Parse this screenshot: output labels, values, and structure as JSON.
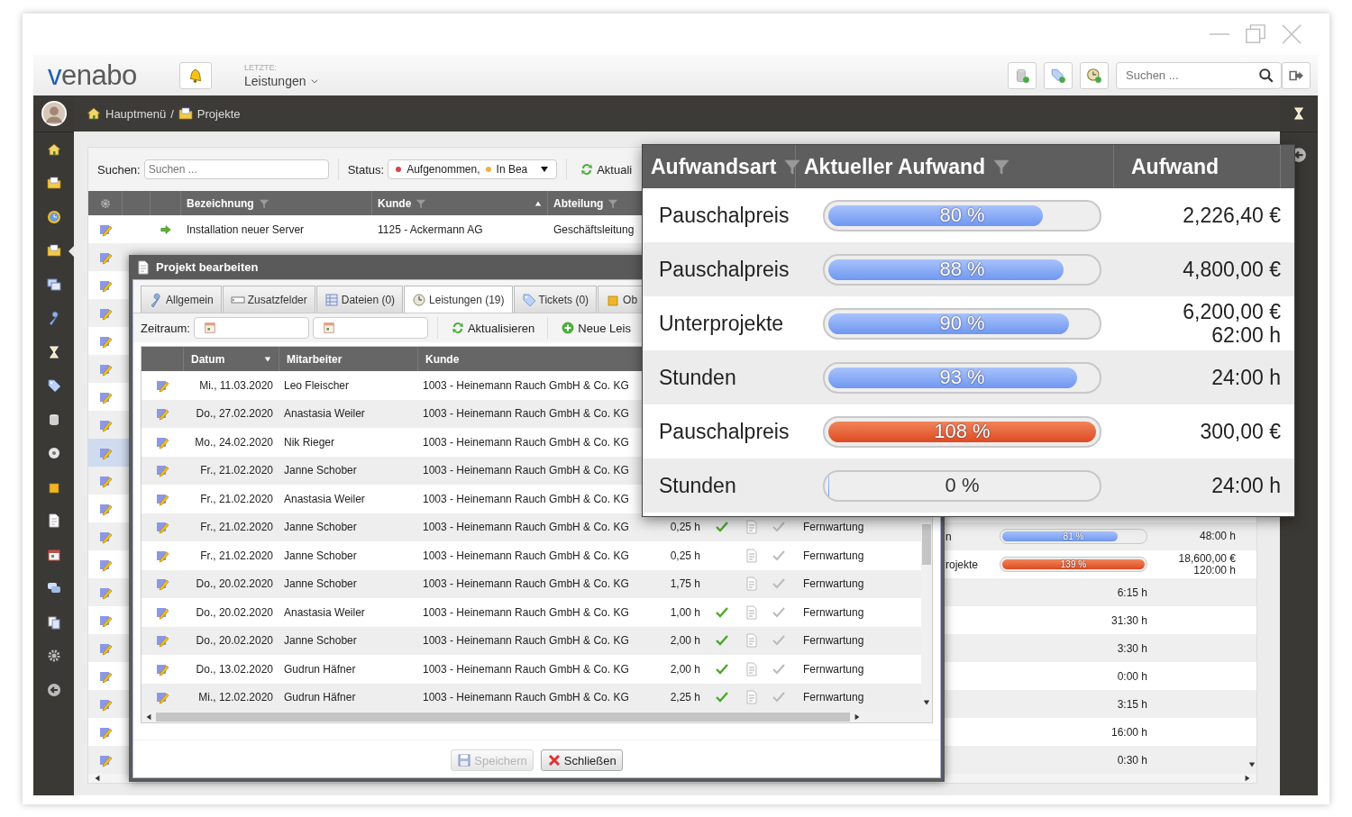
{
  "topbar": {
    "logo": "venabo",
    "recent_label": "LETZTE:",
    "recent_value": "Leistungen",
    "search_placeholder": "Suchen ..."
  },
  "breadcrumb": {
    "items": [
      "Hauptmenü",
      "Projekte"
    ],
    "separator": "/"
  },
  "sidebar": {
    "items": [
      {
        "selected": false
      },
      {
        "selected": false
      },
      {
        "selected": false
      },
      {
        "selected": true
      },
      {
        "selected": false
      },
      {
        "selected": false
      },
      {
        "selected": false
      },
      {
        "selected": false
      },
      {
        "selected": false
      },
      {
        "selected": false
      },
      {
        "selected": false
      },
      {
        "selected": false
      },
      {
        "selected": false
      },
      {
        "selected": false
      },
      {
        "selected": false
      },
      {
        "selected": false
      },
      {
        "selected": false
      }
    ]
  },
  "toolbar": {
    "search_label": "Suchen:",
    "search_placeholder": "Suchen ...",
    "status_label": "Status:",
    "status_values": [
      {
        "label": "Aufgenommen,",
        "color": "#d9434b"
      },
      {
        "label": "In Bea",
        "color": "#f0b040"
      }
    ],
    "refresh": "Aktuali"
  },
  "table": {
    "columns": [
      "Bezeichnung",
      "Kunde",
      "Abteilung"
    ],
    "rows": [
      {
        "selected": false,
        "name": "Installation neuer Server",
        "customer": "1125 - Ackermann AG",
        "department": "Geschäftsleitung"
      },
      {
        "selected": false
      },
      {
        "selected": false
      },
      {
        "selected": false
      },
      {
        "selected": false
      },
      {
        "selected": false
      },
      {
        "selected": false
      },
      {
        "selected": false
      },
      {
        "selected": true
      },
      {
        "selected": false
      },
      {
        "selected": false
      },
      {
        "selected": false,
        "type": "n",
        "level": 0.81,
        "overrun": false,
        "reading": "81 %",
        "amount": [
          "48:00 h"
        ]
      },
      {
        "selected": false,
        "type": "rojekte",
        "level": 1,
        "overrun": true,
        "reading": "139 %",
        "amount": [
          "18,600,00 €",
          "120:00 h"
        ]
      },
      {
        "selected": false,
        "current": "6:15 h"
      },
      {
        "selected": false,
        "current": "31:30 h"
      },
      {
        "selected": false,
        "current": "3:30 h"
      },
      {
        "selected": false,
        "current": "0:00 h"
      },
      {
        "selected": false,
        "current": "3:15 h"
      },
      {
        "selected": false,
        "current": "16:00 h"
      },
      {
        "selected": false,
        "current": "0:30 h"
      }
    ]
  },
  "dialog": {
    "title": "Projekt bearbeiten",
    "tabs": [
      {
        "label": "Allgemein",
        "selected": false
      },
      {
        "label": "Zusatzfelder",
        "selected": false
      },
      {
        "label": "Dateien (0)",
        "selected": false
      },
      {
        "label": "Leistungen (19)",
        "selected": true
      },
      {
        "label": "Tickets (0)",
        "selected": false
      },
      {
        "label": "Ob",
        "selected": false
      }
    ],
    "period_label": "Zeitraum:",
    "refresh": "Aktualisieren",
    "new": "Neue Leis",
    "columns": [
      "Datum",
      "Mitarbeiter",
      "Kunde"
    ],
    "rows": [
      {
        "date": "Mi., 11.03.2020",
        "employee": "Leo Fleischer",
        "customer": "1003 - Heinemann Rauch GmbH & Co. KG"
      },
      {
        "date": "Do., 27.02.2020",
        "employee": "Anastasia Weiler",
        "customer": "1003 - Heinemann Rauch GmbH & Co. KG"
      },
      {
        "date": "Mo., 24.02.2020",
        "employee": "Nik Rieger",
        "customer": "1003 - Heinemann Rauch GmbH & Co. KG"
      },
      {
        "date": "Fr., 21.02.2020",
        "employee": "Janne Schober",
        "customer": "1003 - Heinemann Rauch GmbH & Co. KG"
      },
      {
        "date": "Fr., 21.02.2020",
        "employee": "Anastasia Weiler",
        "customer": "1003 - Heinemann Rauch GmbH & Co. KG"
      },
      {
        "date": "Fr., 21.02.2020",
        "employee": "Janne Schober",
        "customer": "1003 - Heinemann Rauch GmbH & Co. KG",
        "hours": "0,25 h",
        "approved": true,
        "activity": "Fernwartung"
      },
      {
        "date": "Fr., 21.02.2020",
        "employee": "Janne Schober",
        "customer": "1003 - Heinemann Rauch GmbH & Co. KG",
        "hours": "0,25 h",
        "approved": false,
        "activity": "Fernwartung"
      },
      {
        "date": "Do., 20.02.2020",
        "employee": "Janne Schober",
        "customer": "1003 - Heinemann Rauch GmbH & Co. KG",
        "hours": "1,75 h",
        "approved": false,
        "activity": "Fernwartung"
      },
      {
        "date": "Do., 20.02.2020",
        "employee": "Anastasia Weiler",
        "customer": "1003 - Heinemann Rauch GmbH & Co. KG",
        "hours": "1,00 h",
        "approved": true,
        "activity": "Fernwartung"
      },
      {
        "date": "Do., 20.02.2020",
        "employee": "Janne Schober",
        "customer": "1003 - Heinemann Rauch GmbH & Co. KG",
        "hours": "2,00 h",
        "approved": true,
        "activity": "Fernwartung"
      },
      {
        "date": "Do., 13.02.2020",
        "employee": "Gudrun Häfner",
        "customer": "1003 - Heinemann Rauch GmbH & Co. KG",
        "hours": "2,00 h",
        "approved": true,
        "activity": "Fernwartung"
      },
      {
        "date": "Mi., 12.02.2020",
        "employee": "Gudrun Häfner",
        "customer": "1003 - Heinemann Rauch GmbH & Co. KG",
        "hours": "2,25 h",
        "approved": true,
        "activity": "Fernwartung"
      }
    ],
    "buttons": [
      {
        "label": "Speichern",
        "kind": "save",
        "disabled": true
      },
      {
        "label": "Schließen",
        "kind": "close",
        "disabled": false
      }
    ]
  },
  "magnifier": {
    "columns": [
      "Aufwandsart",
      "Aktueller Aufwand",
      "Aufwand"
    ],
    "rows": [
      {
        "type": "Pauschalpreis",
        "level": 0.8,
        "overrun": false,
        "reading": "80 %",
        "amount": [
          "2,226,40 €"
        ]
      },
      {
        "type": "Pauschalpreis",
        "level": 0.88,
        "overrun": false,
        "reading": "88 %",
        "amount": [
          "4,800,00 €"
        ]
      },
      {
        "type": "Unterprojekte",
        "level": 0.9,
        "overrun": false,
        "reading": "90 %",
        "amount": [
          "6,200,00 €",
          "62:00 h"
        ]
      },
      {
        "type": "Stunden",
        "level": 0.93,
        "overrun": false,
        "reading": "93 %",
        "amount": [
          "24:00 h"
        ]
      },
      {
        "type": "Pauschalpreis",
        "level": 1,
        "overrun": true,
        "reading": "108 %",
        "amount": [
          "300,00 €"
        ]
      },
      {
        "type": "Stunden",
        "level": 0,
        "reading": "0 %",
        "amount": [
          "24:00 h"
        ]
      }
    ]
  }
}
